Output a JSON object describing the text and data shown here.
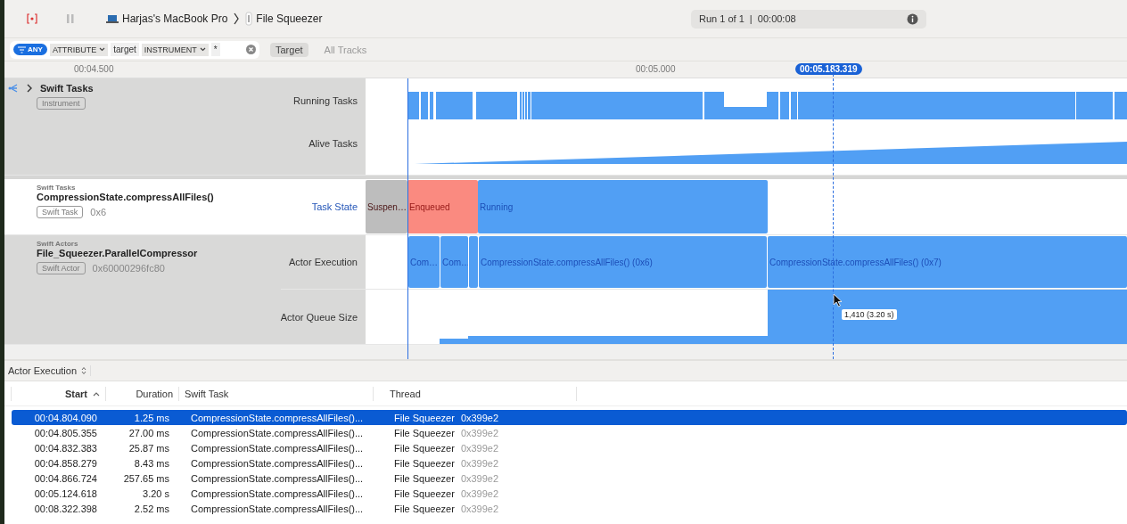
{
  "toolbar": {
    "device": "Harjas's MacBook Pro",
    "target": "File Squeezer",
    "run_status": "Run 1 of 1  |  00:00:08"
  },
  "filter": {
    "badge": "ANY",
    "tokens": [
      {
        "kind": "menu",
        "text": "ATTRIBUTE"
      },
      {
        "kind": "value",
        "text": "target"
      },
      {
        "kind": "menu",
        "text": "INSTRUMENT"
      },
      {
        "kind": "value",
        "text": "*"
      }
    ],
    "scopes": [
      {
        "label": "Target",
        "selected": true
      },
      {
        "label": "All Tracks",
        "selected": false
      }
    ]
  },
  "ruler": {
    "ticks": [
      "00:04.500",
      "00:05.000"
    ],
    "cursor": "00:05.183.319"
  },
  "groups": [
    {
      "title": "Swift Tasks",
      "tag": "Instrument",
      "highlighted": true,
      "expanded": false,
      "lanes": [
        {
          "label": "Running Tasks",
          "kind": "running",
          "selected": false
        },
        {
          "label": "Alive Tasks",
          "kind": "alive",
          "selected": false
        }
      ]
    },
    {
      "category": "Swift Tasks",
      "title": "CompressionState.compressAllFiles()",
      "tag": "Swift Task",
      "id": "0x6",
      "highlighted": false,
      "lanes": [
        {
          "label": "Task State",
          "kind": "states",
          "selected": true,
          "segments": [
            {
              "color": "#bdbdbd",
              "text": "Suspen…"
            },
            {
              "color": "#fa8a80",
              "text": "Enqueued"
            },
            {
              "color": "#519ff4",
              "text": "Running"
            }
          ]
        }
      ]
    },
    {
      "category": "Swift Actors",
      "title": "File_Squeezer.ParallelCompressor",
      "tag": "Swift Actor",
      "id": "0x60000296fc80",
      "highlighted": true,
      "lanes": [
        {
          "label": "Actor Execution",
          "kind": "intervals",
          "selected": false,
          "segments": [
            {
              "kind": "labeled",
              "text": "Com…"
            },
            {
              "kind": "labeled",
              "text": "Com…"
            },
            {
              "kind": "plain"
            },
            {
              "kind": "labeled",
              "text": "CompressionState.compressAllFiles() (0x6)"
            },
            {
              "kind": "labeled",
              "text": "CompressionState.compressAllFiles() (0x7)"
            }
          ]
        },
        {
          "label": "Actor Queue Size",
          "kind": "queue",
          "selected": false
        }
      ]
    }
  ],
  "tooltip": "1,410 (3.20 s)",
  "detail": {
    "title": "Actor Execution",
    "columns": [
      {
        "label": "Start",
        "sorted": true
      },
      {
        "label": "Duration",
        "sorted": false
      },
      {
        "label": "Swift Task",
        "sorted": false
      },
      {
        "label": "Thread",
        "sorted": false
      }
    ],
    "rows": [
      {
        "start": "00:04.804.090",
        "duration": "1.25 ms",
        "task": "CompressionState.compressAllFiles()...",
        "thread": "File Squeezer",
        "thread_id": "0x399e2",
        "selected": true
      },
      {
        "start": "00:04.805.355",
        "duration": "27.00 ms",
        "task": "CompressionState.compressAllFiles()...",
        "thread": "File Squeezer",
        "thread_id": "0x399e2",
        "selected": false
      },
      {
        "start": "00:04.832.383",
        "duration": "25.87 ms",
        "task": "CompressionState.compressAllFiles()...",
        "thread": "File Squeezer",
        "thread_id": "0x399e2",
        "selected": false
      },
      {
        "start": "00:04.858.279",
        "duration": "8.43 ms",
        "task": "CompressionState.compressAllFiles()...",
        "thread": "File Squeezer",
        "thread_id": "0x399e2",
        "selected": false
      },
      {
        "start": "00:04.866.724",
        "duration": "257.65 ms",
        "task": "CompressionState.compressAllFiles()...",
        "thread": "File Squeezer",
        "thread_id": "0x399e2",
        "selected": false
      },
      {
        "start": "00:05.124.618",
        "duration": "3.20 s",
        "task": "CompressionState.compressAllFiles()...",
        "thread": "File Squeezer",
        "thread_id": "0x399e2",
        "selected": false
      },
      {
        "start": "00:08.322.398",
        "duration": "2.52 ms",
        "task": "CompressionState.compressAllFiles()...",
        "thread": "File Squeezer",
        "thread_id": "0x399e2",
        "selected": false
      }
    ]
  }
}
